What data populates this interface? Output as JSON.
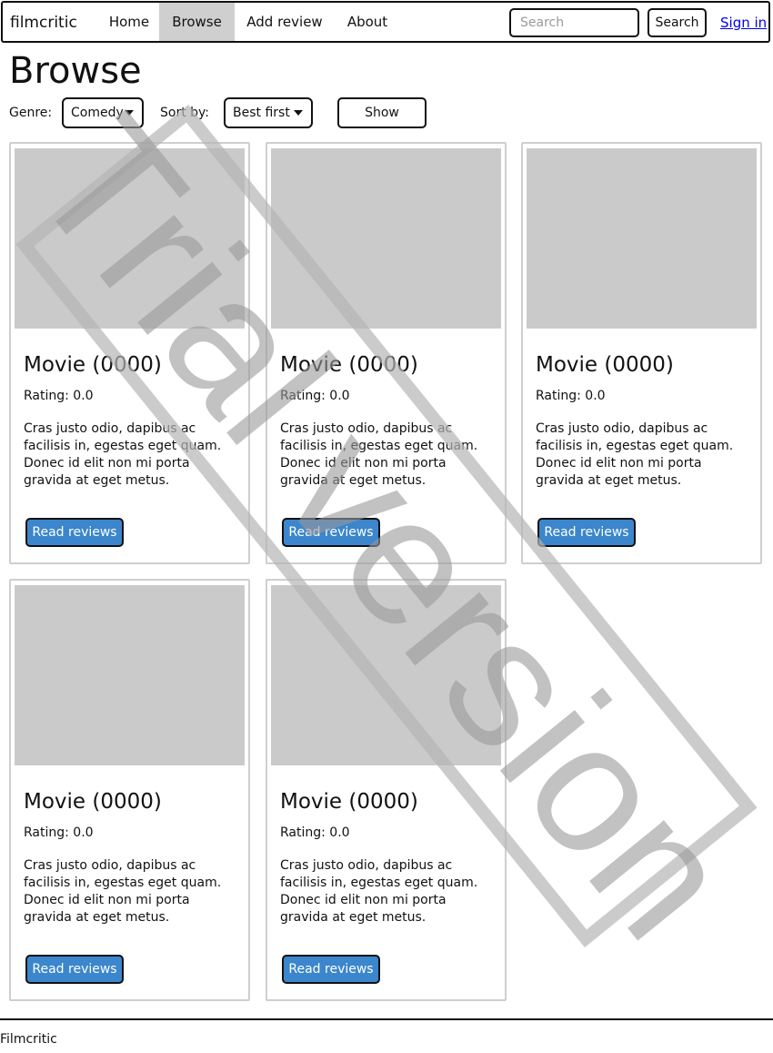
{
  "navbar": {
    "brand": "filmcritic",
    "items": [
      {
        "label": "Home",
        "active": false
      },
      {
        "label": "Browse",
        "active": true
      },
      {
        "label": "Add review",
        "active": false
      },
      {
        "label": "About",
        "active": false
      }
    ],
    "search": {
      "placeholder": "Search",
      "button_label": "Search"
    },
    "signin_label": "Sign in"
  },
  "page": {
    "title": "Browse"
  },
  "filters": {
    "genre_label": "Genre:",
    "genre_value": "Comedy",
    "sort_label": "Sort by:",
    "sort_value": "Best first",
    "show_label": "Show"
  },
  "movies": [
    {
      "title": "Movie (0000)",
      "rating": "Rating: 0.0",
      "description": "Cras justo odio, dapibus ac facilisis in, egestas eget quam. Donec id elit non mi porta gravida at eget metus.",
      "button_label": "Read reviews"
    },
    {
      "title": "Movie (0000)",
      "rating": "Rating: 0.0",
      "description": "Cras justo odio, dapibus ac facilisis in, egestas eget quam. Donec id elit non mi porta gravida at eget metus.",
      "button_label": "Read reviews"
    },
    {
      "title": "Movie (0000)",
      "rating": "Rating: 0.0",
      "description": "Cras justo odio, dapibus ac facilisis in, egestas eget quam. Donec id elit non mi porta gravida at eget metus.",
      "button_label": "Read reviews"
    },
    {
      "title": "Movie (0000)",
      "rating": "Rating: 0.0",
      "description": "Cras justo odio, dapibus ac facilisis in, egestas eget quam. Donec id elit non mi porta gravida at eget metus.",
      "button_label": "Read reviews"
    },
    {
      "title": "Movie (0000)",
      "rating": "Rating: 0.0",
      "description": "Cras justo odio, dapibus ac facilisis in, egestas eget quam. Donec id elit non mi porta gravida at eget metus.",
      "button_label": "Read reviews"
    }
  ],
  "footer": {
    "text": "Filmcritic"
  },
  "watermark": {
    "text": "Trial version"
  },
  "colors": {
    "accent_button": "#3b86cc",
    "image_placeholder": "#cacaca",
    "active_nav": "#cfcfcf",
    "link": "#0000ee"
  }
}
